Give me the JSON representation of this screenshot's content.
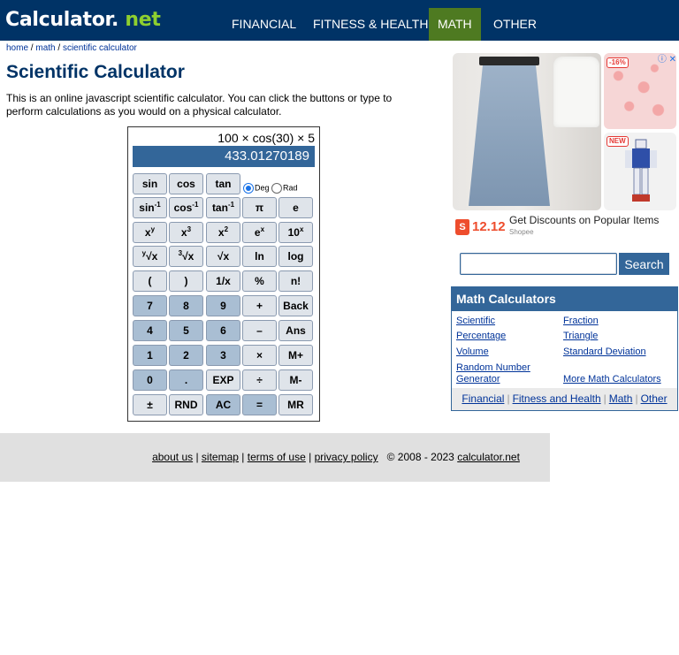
{
  "header": {
    "logo_main": "Calculator",
    "logo_dot": ".",
    "logo_net": " net",
    "nav": [
      "FINANCIAL",
      "FITNESS & HEALTH",
      "MATH",
      "OTHER"
    ],
    "active_nav": "MATH"
  },
  "breadcrumb": {
    "home": "home",
    "math": "math",
    "current": "scientific calculator",
    "sep": " / "
  },
  "page": {
    "title": "Scientific Calculator",
    "intro": "This is an online javascript scientific calculator. You can click the buttons or type to perform calculations as you would on a physical calculator."
  },
  "calculator": {
    "expression": "100 × cos(30) × 5",
    "result": "433.01270189",
    "angle_modes": [
      "Deg",
      "Rad"
    ],
    "selected_mode": "Deg",
    "keys": {
      "sin": "sin",
      "cos": "cos",
      "tan": "tan",
      "asin": "sin",
      "acos": "cos",
      "atan": "tan",
      "inv_sup": "-1",
      "pi": "π",
      "e": "e",
      "xy_base": "x",
      "xy_sup": "y",
      "x3_base": "x",
      "x3_sup": "3",
      "x2_base": "x",
      "x2_sup": "2",
      "ex_base": "e",
      "ex_sup": "x",
      "tenx_base": "10",
      "tenx_sup": "x",
      "yroot_sup": "y",
      "yroot_body": "√x",
      "cbrt_sup": "3",
      "cbrt_body": "√x",
      "sqrt": "√x",
      "ln": "ln",
      "log": "log",
      "lparen": "(",
      "rparen": ")",
      "recip": "1/x",
      "percent": "%",
      "fact": "n!",
      "7": "7",
      "8": "8",
      "9": "9",
      "plus": "+",
      "back": "Back",
      "4": "4",
      "5": "5",
      "6": "6",
      "minus": "–",
      "ans": "Ans",
      "1": "1",
      "2": "2",
      "3": "3",
      "times": "×",
      "mplus": "M+",
      "0": "0",
      "dot": ".",
      "exp": "EXP",
      "divide": "÷",
      "mminus": "M-",
      "plusminus": "±",
      "rnd": "RND",
      "ac": "AC",
      "equals": "=",
      "mr": "MR"
    }
  },
  "footer": {
    "links": [
      "about us",
      "sitemap",
      "terms of use",
      "privacy policy"
    ],
    "separator": " | ",
    "copyright": "© 2008 - 2023",
    "site": "calculator.net"
  },
  "ad": {
    "discount_badge": "-16%",
    "new_badge": "NEW",
    "adchoices": "ⓘ ✕",
    "sale_text": "12.12",
    "headline": "Get Discounts on Popular Items",
    "source": "Shopee",
    "colors": {
      "brand": "#ee4d2d"
    }
  },
  "search": {
    "value": "",
    "button": "Search"
  },
  "math_calculators": {
    "heading": "Math Calculators",
    "links_left": [
      "Scientific",
      "Percentage",
      "Volume",
      "Random Number Generator"
    ],
    "links_right": [
      "Fraction",
      "Triangle",
      "Standard Deviation",
      "More Math Calculators"
    ],
    "footer_links": [
      "Financial",
      "Fitness and Health",
      "Math",
      "Other"
    ],
    "separator": "|"
  },
  "colors": {
    "header_bg": "#003366",
    "nav_active_bg": "#4e7a21",
    "logo_accent": "#8ecf2f",
    "accent_blue": "#336699",
    "footer_bg": "#e0e0e0"
  }
}
